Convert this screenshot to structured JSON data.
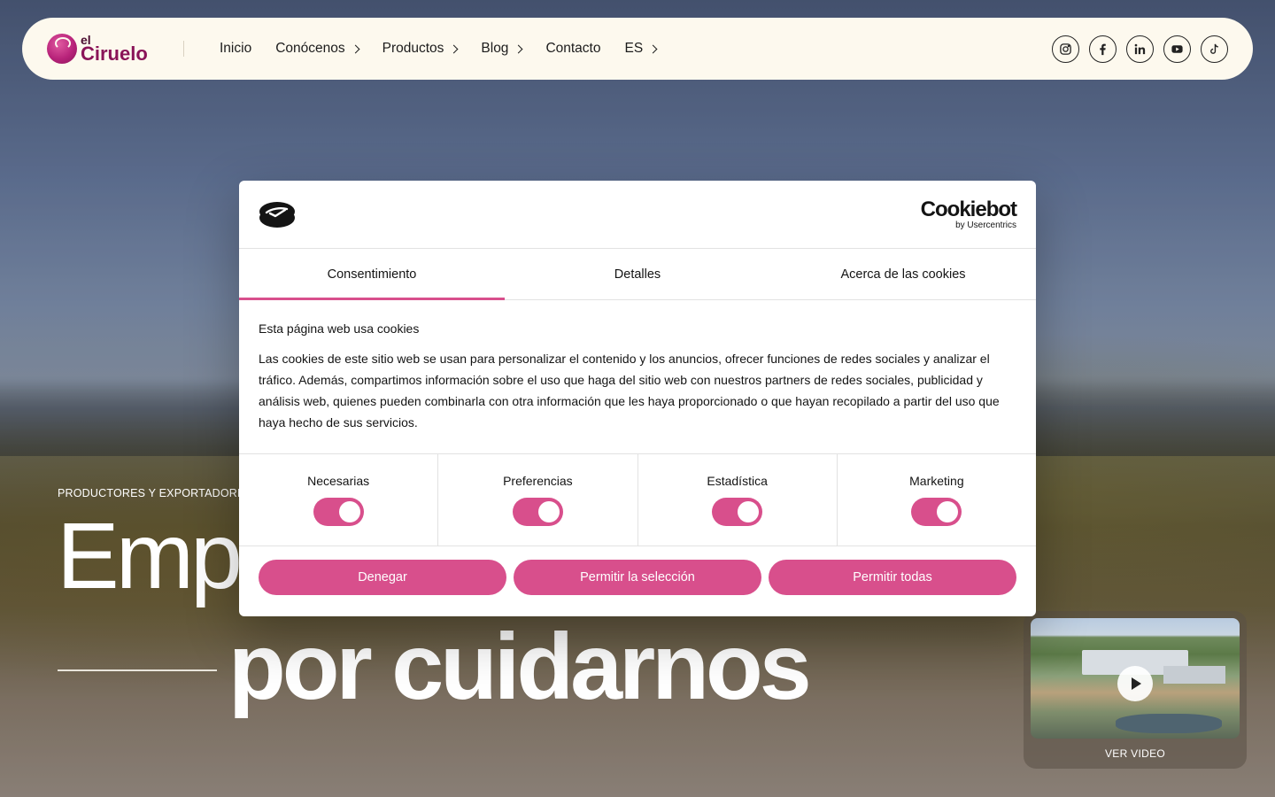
{
  "header": {
    "logo": {
      "line1": "el",
      "line2": "Ciruelo"
    },
    "nav": [
      {
        "label": "Inicio",
        "has_chevron": false
      },
      {
        "label": "Conócenos",
        "has_chevron": true
      },
      {
        "label": "Productos",
        "has_chevron": true
      },
      {
        "label": "Blog",
        "has_chevron": true
      },
      {
        "label": "Contacto",
        "has_chevron": false
      },
      {
        "label": "ES",
        "has_chevron": true
      }
    ],
    "socials": [
      "instagram-icon",
      "facebook-icon",
      "linkedin-icon",
      "youtube-icon",
      "tiktok-icon"
    ]
  },
  "hero": {
    "eyebrow": "PRODUCTORES Y EXPORTADORES",
    "title_line1": "Emp",
    "title_line2": "por cuidarnos",
    "video_label": "VER VIDEO"
  },
  "cookie": {
    "brand_title": "Cookiebot",
    "brand_sub": "by Usercentrics",
    "tabs": [
      {
        "label": "Consentimiento",
        "active": true
      },
      {
        "label": "Detalles",
        "active": false
      },
      {
        "label": "Acerca de las cookies",
        "active": false
      }
    ],
    "heading": "Esta página web usa cookies",
    "body": "Las cookies de este sitio web se usan para personalizar el contenido y los anuncios, ofrecer funciones de redes sociales y analizar el tráfico. Además, compartimos información sobre el uso que haga del sitio web con nuestros partners de redes sociales, publicidad y análisis web, quienes pueden combinarla con otra información que les haya proporcionado o que hayan recopilado a partir del uso que haya hecho de sus servicios.",
    "toggles": [
      {
        "label": "Necesarias",
        "on": true
      },
      {
        "label": "Preferencias",
        "on": true
      },
      {
        "label": "Estadística",
        "on": true
      },
      {
        "label": "Marketing",
        "on": true
      }
    ],
    "buttons": {
      "deny": "Denegar",
      "allow_selection": "Permitir la selección",
      "allow_all": "Permitir todas"
    }
  },
  "colors": {
    "accent": "#d84f8c",
    "brand": "#8a1458",
    "header_bg": "#fdf9ee"
  }
}
